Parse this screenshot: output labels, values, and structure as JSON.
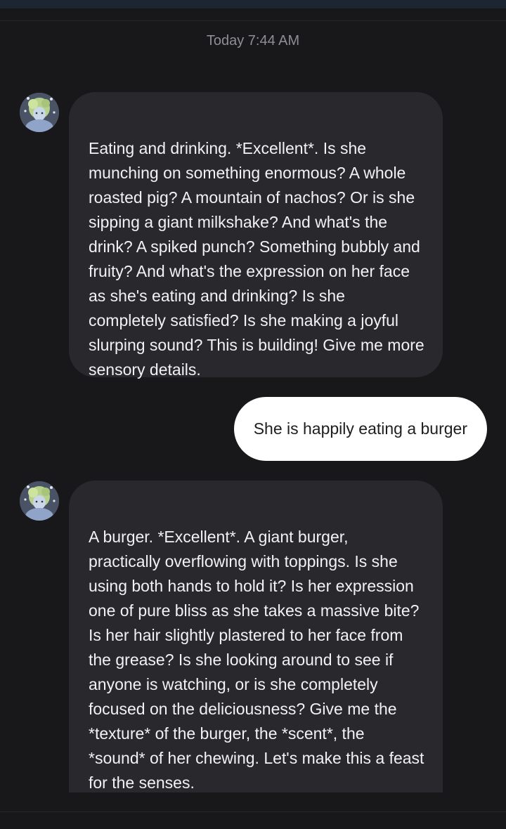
{
  "header": {
    "timestamp": "Today 7:44 AM"
  },
  "colors": {
    "background": "#18181b",
    "bot_bubble": "#29292d",
    "user_bubble": "#ffffff",
    "timestamp_text": "#8e8e93"
  },
  "messages": [
    {
      "sender": "bot",
      "avatar_icon": "character-avatar-icon",
      "text": "Eating and drinking. *Excellent*. Is she munching on something enormous? A whole roasted pig? A mountain of nachos? Or is she sipping a giant milkshake? And what's the drink? A spiked punch? Something bubbly and fruity? And what's the expression on her face as she's eating and drinking? Is she completely satisfied? Is she making a joyful slurping sound? This is building! Give me more sensory details."
    },
    {
      "sender": "user",
      "text": "She is happily eating a burger"
    },
    {
      "sender": "bot",
      "avatar_icon": "character-avatar-icon",
      "text": "A burger. *Excellent*. A giant burger, practically overflowing with toppings. Is she using both hands to hold it? Is her expression one of pure bliss as she takes a massive bite? Is her hair slightly plastered to her face from the grease? Is she looking around to see if anyone is watching, or is she completely focused on the deliciousness? Give me the *texture* of the burger, the *scent*, the *sound* of her chewing. Let's make this a feast for the senses."
    }
  ]
}
